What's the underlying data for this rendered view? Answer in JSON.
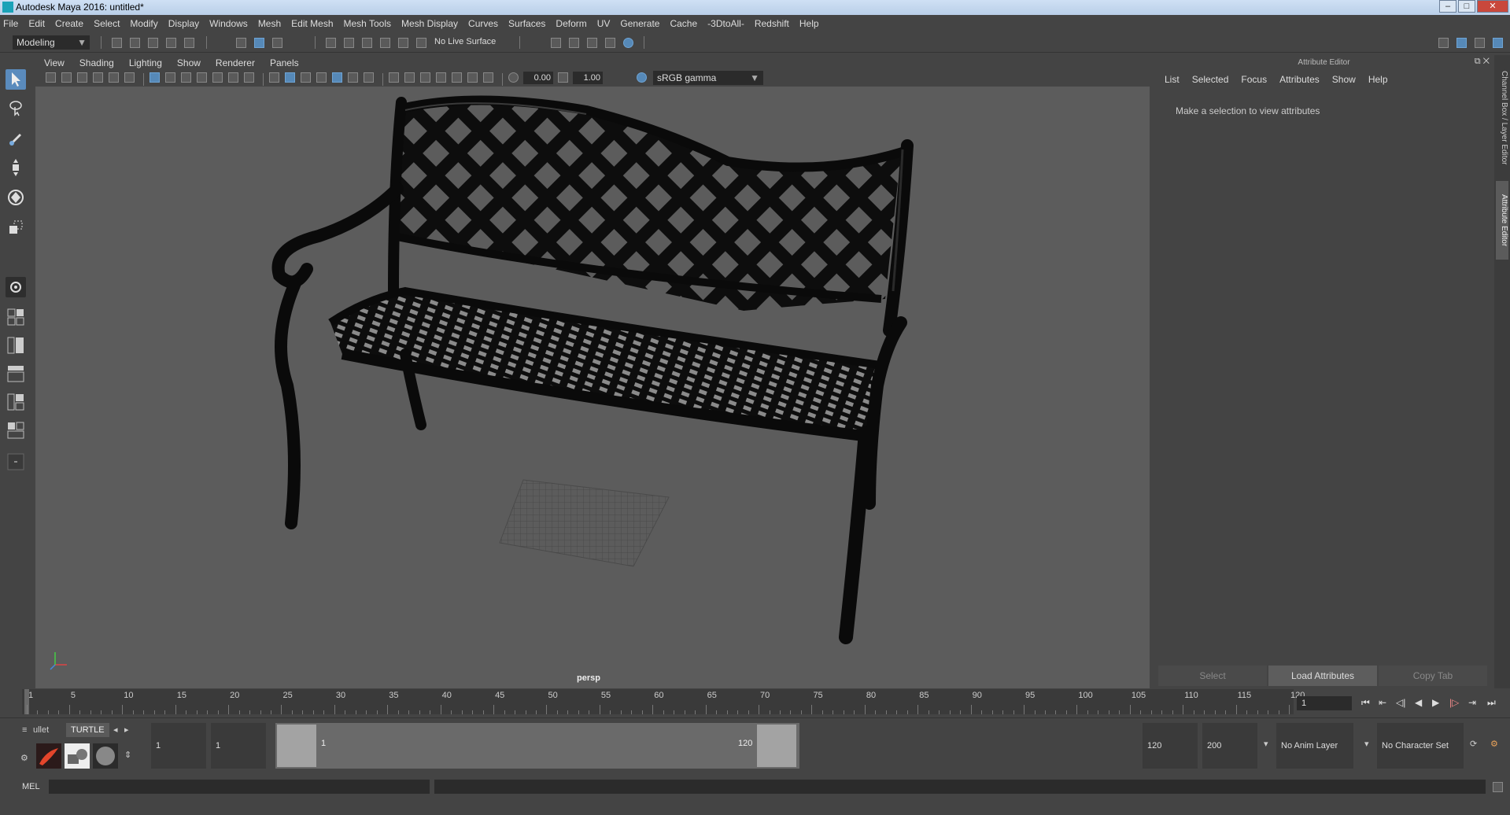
{
  "window": {
    "title": "Autodesk Maya 2016: untitled*"
  },
  "menubar": [
    "File",
    "Edit",
    "Create",
    "Select",
    "Modify",
    "Display",
    "Windows",
    "Mesh",
    "Edit Mesh",
    "Mesh Tools",
    "Mesh Display",
    "Curves",
    "Surfaces",
    "Deform",
    "UV",
    "Generate",
    "Cache",
    "-3DtoAll-",
    "Redshift",
    "Help"
  ],
  "toolbar": {
    "mode": "Modeling",
    "live_surface": "No Live Surface"
  },
  "viewport": {
    "menus": [
      "View",
      "Shading",
      "Lighting",
      "Show",
      "Renderer",
      "Panels"
    ],
    "exposure": "0.00",
    "gamma_value": "1.00",
    "color_space": "sRGB gamma",
    "camera_label": "persp"
  },
  "attribute_editor": {
    "header": "Attribute Editor",
    "menus": [
      "List",
      "Selected",
      "Focus",
      "Attributes",
      "Show",
      "Help"
    ],
    "message": "Make a selection to view attributes",
    "buttons": {
      "select": "Select",
      "load": "Load Attributes",
      "copy": "Copy Tab"
    }
  },
  "side_tabs": {
    "channel_box": "Channel Box / Layer Editor",
    "attribute_editor": "Attribute Editor"
  },
  "timeline": {
    "ticks": [
      "1",
      "5",
      "10",
      "15",
      "20",
      "25",
      "30",
      "35",
      "40",
      "45",
      "50",
      "55",
      "60",
      "65",
      "70",
      "75",
      "80",
      "85",
      "90",
      "95",
      "100",
      "105",
      "110",
      "115",
      "120"
    ],
    "current_frame": "1"
  },
  "range": {
    "shelf_tabs": [
      "ullet",
      "TURTLE"
    ],
    "start": "1",
    "playback_start": "1",
    "slider_start": "1",
    "slider_end": "120",
    "playback_end": "120",
    "end": "200",
    "anim_layer": "No Anim Layer",
    "character_set": "No Character Set"
  },
  "command_line": {
    "label": "MEL"
  }
}
